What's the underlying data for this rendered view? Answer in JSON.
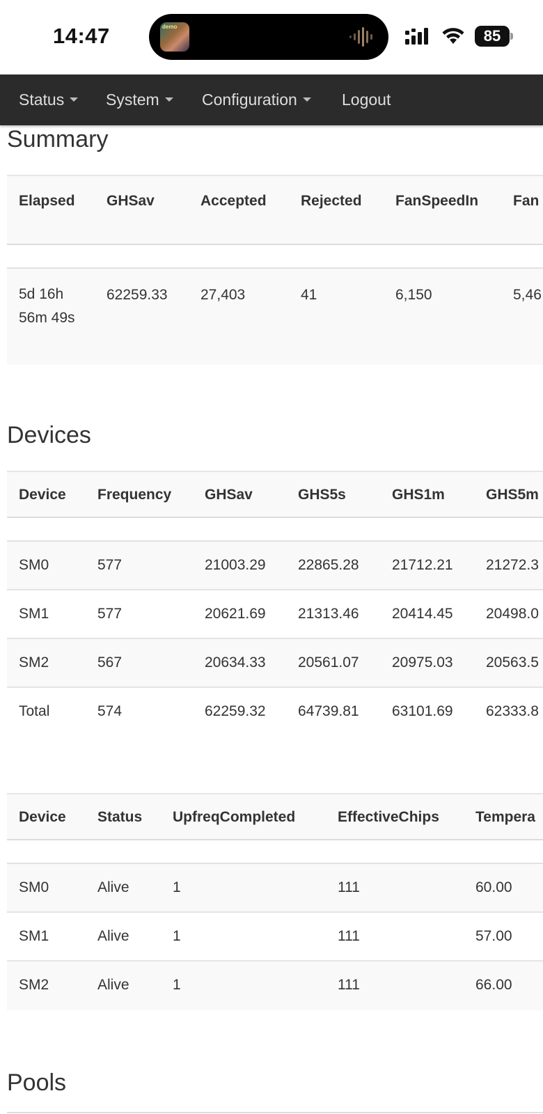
{
  "status_bar": {
    "time": "14:47",
    "island_art_text": "demo",
    "battery": "85",
    "icons": [
      "cellular-signal-icon",
      "wifi-icon",
      "battery-icon",
      "audio-waveform-icon"
    ]
  },
  "nav": {
    "items": [
      {
        "label": "Status",
        "dropdown": true
      },
      {
        "label": "System",
        "dropdown": true
      },
      {
        "label": "Configuration",
        "dropdown": true
      },
      {
        "label": "Logout",
        "dropdown": false
      }
    ],
    "background": "#2b2b2b"
  },
  "summary": {
    "title": "Summary",
    "headers": [
      "Elapsed",
      "GHSav",
      "Accepted",
      "Rejected",
      "FanSpeedIn",
      "Fan"
    ],
    "row": [
      "5d 16h 56m 49s",
      "62259.33",
      "27,403",
      "41",
      "6,150",
      "5,46"
    ]
  },
  "devices": {
    "title": "Devices",
    "headers": [
      "Device",
      "Frequency",
      "GHSav",
      "GHS5s",
      "GHS1m",
      "GHS5m"
    ],
    "rows": [
      [
        "SM0",
        "577",
        "21003.29",
        "22865.28",
        "21712.21",
        "21272.3"
      ],
      [
        "SM1",
        "577",
        "20621.69",
        "21313.46",
        "20414.45",
        "20498.0"
      ],
      [
        "SM2",
        "567",
        "20634.33",
        "20561.07",
        "20975.03",
        "20563.5"
      ],
      [
        "Total",
        "574",
        "62259.32",
        "64739.81",
        "63101.69",
        "62333.8"
      ]
    ]
  },
  "chains": {
    "headers": [
      "Device",
      "Status",
      "UpfreqCompleted",
      "EffectiveChips",
      "Tempera"
    ],
    "rows": [
      [
        "SM0",
        "Alive",
        "1",
        "111",
        "60.00"
      ],
      [
        "SM1",
        "Alive",
        "1",
        "111",
        "57.00"
      ],
      [
        "SM2",
        "Alive",
        "1",
        "111",
        "66.00"
      ]
    ]
  },
  "pools": {
    "title": "Pools"
  }
}
